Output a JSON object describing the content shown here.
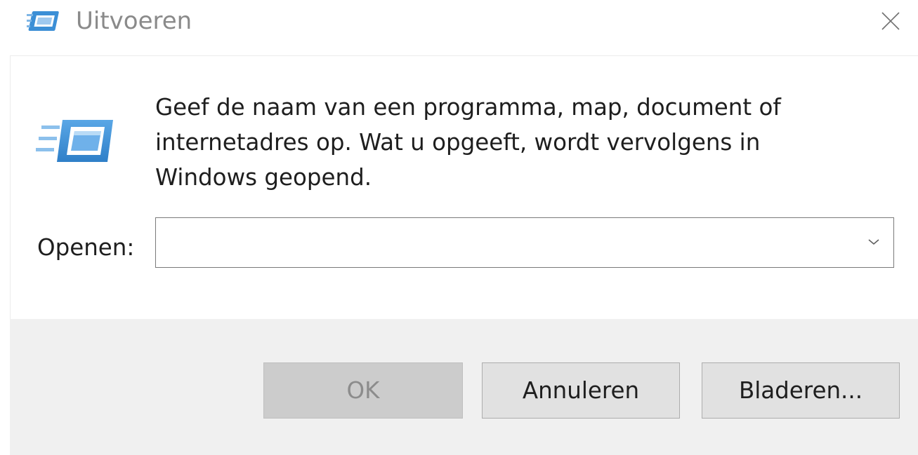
{
  "window": {
    "title": "Uitvoeren",
    "icon": "run-dialog-icon"
  },
  "dialog": {
    "description_lines": [
      "Geef de naam van een programma, map, document of",
      "internetadres op. Wat u opgeeft, wordt vervolgens in",
      "Windows geopend."
    ],
    "open_label": "Openen:",
    "open_value": ""
  },
  "buttons": {
    "ok": "OK",
    "cancel": "Annuleren",
    "browse": "Bladeren..."
  },
  "colors": {
    "icon_blue": "#3c8fd6",
    "ok_disabled_bg": "#cccccc",
    "footer_bg": "#f0f0f0"
  }
}
